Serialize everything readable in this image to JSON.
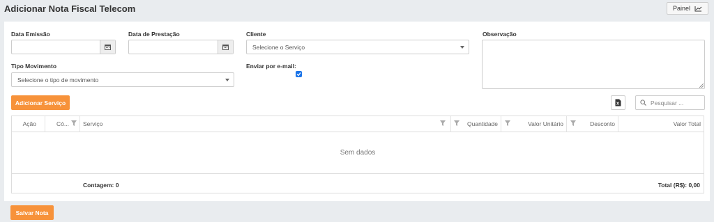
{
  "header": {
    "title": "Adicionar Nota Fiscal Telecom",
    "painel_label": "Painel"
  },
  "form": {
    "data_emissao": {
      "label": "Data Emissão",
      "value": ""
    },
    "data_prestacao": {
      "label": "Data de Prestação",
      "value": ""
    },
    "cliente": {
      "label": "Cliente",
      "placeholder": "Selecione o Serviço"
    },
    "observacao": {
      "label": "Observação",
      "value": ""
    },
    "tipo_movimento": {
      "label": "Tipo Movimento",
      "placeholder": "Selecione o tipo de movimento"
    },
    "enviar_email": {
      "label": "Enviar por e-mail:",
      "checked": true
    }
  },
  "toolbar": {
    "add_service_label": "Adicionar Serviço",
    "search_placeholder": "Pesquisar ..."
  },
  "grid": {
    "columns": [
      "Ação",
      "Có...",
      "Serviço",
      "Quantidade",
      "Valor Unitário",
      "Desconto",
      "Valor Total"
    ],
    "empty_text": "Sem dados",
    "count_text": "Contagem: 0",
    "total_text": "Total (R$): 0,00"
  },
  "footer": {
    "save_label": "Salvar Nota"
  },
  "colors": {
    "accent": "#f7923a",
    "checkbox": "#1a73e8"
  }
}
